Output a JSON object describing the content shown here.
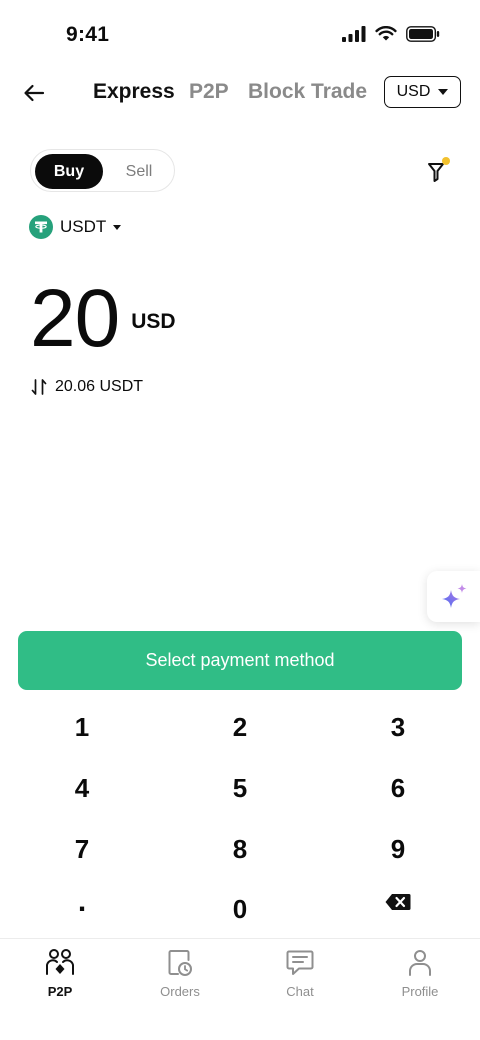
{
  "status_bar": {
    "time": "9:41"
  },
  "nav": {
    "tabs": [
      {
        "label": "Express",
        "active": true
      },
      {
        "label": "P2P",
        "active": false
      },
      {
        "label": "Block Trade",
        "active": false
      }
    ],
    "currency": "USD"
  },
  "trade": {
    "buy_label": "Buy",
    "sell_label": "Sell",
    "selected_side": "Buy",
    "asset": "USDT",
    "asset_icon": "tether-icon",
    "amount": "20",
    "amount_unit": "USD",
    "converted": "20.06 USDT"
  },
  "cta": {
    "label": "Select payment method"
  },
  "keypad": [
    "1",
    "2",
    "3",
    "4",
    "5",
    "6",
    "7",
    "8",
    "9",
    ".",
    "0",
    "backspace"
  ],
  "bottom_nav": [
    {
      "label": "P2P",
      "icon": "p2p-users-icon",
      "active": true
    },
    {
      "label": "Orders",
      "icon": "orders-icon",
      "active": false
    },
    {
      "label": "Chat",
      "icon": "chat-icon",
      "active": false
    },
    {
      "label": "Profile",
      "icon": "profile-icon",
      "active": false
    }
  ],
  "colors": {
    "accent_green": "#30bd86",
    "tether_green": "#26a17b",
    "filter_dot": "#f2c12e",
    "text_primary": "#0b0b0b",
    "text_muted": "#8a8a8a"
  }
}
